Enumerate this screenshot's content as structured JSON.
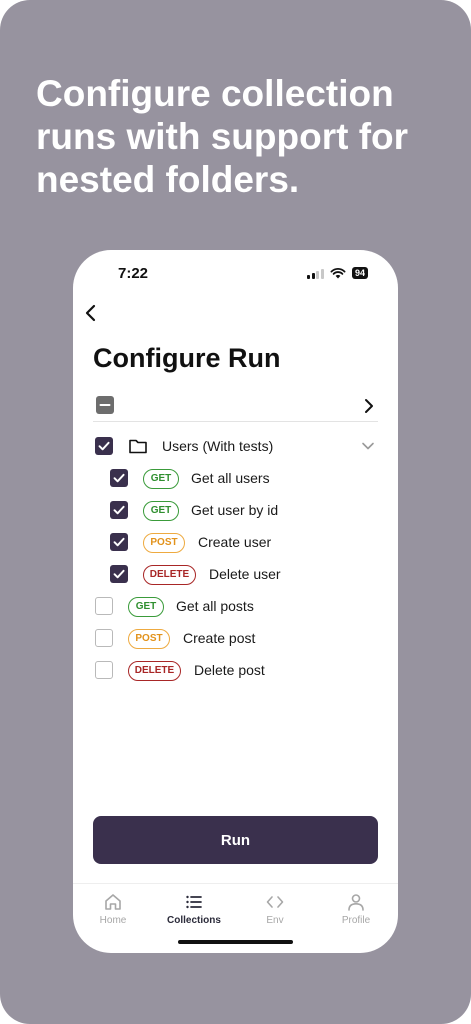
{
  "headline": "Configure collection runs with support for nested folders.",
  "status_bar": {
    "time": "7:22",
    "battery": "94"
  },
  "page": {
    "title": "Configure Run"
  },
  "folder": {
    "label": "Users (With tests)",
    "checked": true
  },
  "requests": [
    {
      "method": "GET",
      "label": "Get all users",
      "checked": true
    },
    {
      "method": "GET",
      "label": "Get user by id",
      "checked": true
    },
    {
      "method": "POST",
      "label": "Create user",
      "checked": true
    },
    {
      "method": "DELETE",
      "label": "Delete user",
      "checked": true
    },
    {
      "method": "GET",
      "label": "Get all posts",
      "checked": false
    },
    {
      "method": "POST",
      "label": "Create post",
      "checked": false
    },
    {
      "method": "DELETE",
      "label": "Delete post",
      "checked": false
    }
  ],
  "run_button": {
    "label": "Run"
  },
  "tabbar": {
    "home": "Home",
    "collections": "Collections",
    "env": "Env",
    "profile": "Profile",
    "active": "collections"
  },
  "colors": {
    "background": "#97939f",
    "primary": "#3a304d",
    "get": "#2f8f2f",
    "post": "#e2921b",
    "delete": "#a82626"
  }
}
